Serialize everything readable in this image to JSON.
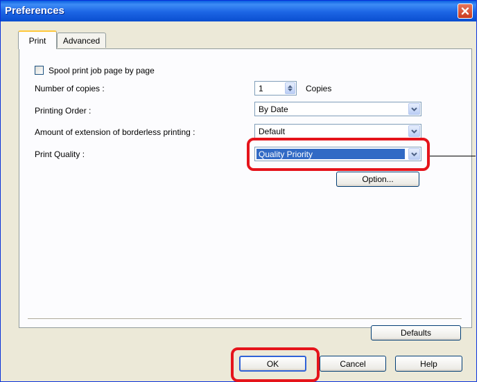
{
  "window": {
    "title": "Preferences"
  },
  "tabs": [
    {
      "label": "Print",
      "active": true
    },
    {
      "label": "Advanced",
      "active": false
    }
  ],
  "print": {
    "spool": {
      "label": "Spool print job page by page",
      "checked": false
    },
    "copies": {
      "label": "Number of copies :",
      "value": "1",
      "unit": "Copies"
    },
    "order": {
      "label": "Printing Order :",
      "value": "By Date"
    },
    "borderless": {
      "label": "Amount of extension of borderless printing :",
      "value": "Default"
    },
    "quality": {
      "label": "Print Quality :",
      "value": "Quality Priority"
    },
    "option_label": "Option...",
    "defaults_label": "Defaults"
  },
  "footer": {
    "ok_label": "OK",
    "cancel_label": "Cancel",
    "help_label": "Help"
  },
  "colors": {
    "title_bar": "#0a5fe0",
    "selection": "#316ac5",
    "highlight": "#e5141b",
    "dialog_bg": "#ece9d8"
  },
  "icons": [
    "close-icon",
    "chevron-down-icon",
    "spin-up-icon",
    "spin-down-icon"
  ]
}
